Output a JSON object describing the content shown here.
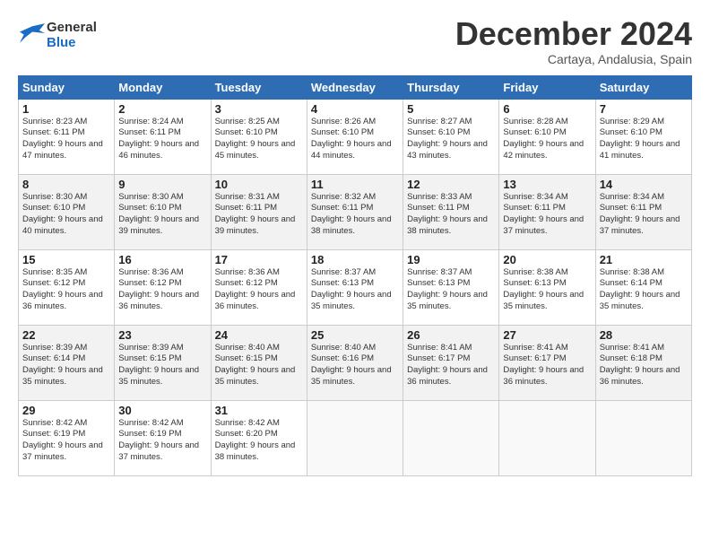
{
  "header": {
    "logo_line1": "General",
    "logo_line2": "Blue",
    "title": "December 2024",
    "subtitle": "Cartaya, Andalusia, Spain"
  },
  "weekdays": [
    "Sunday",
    "Monday",
    "Tuesday",
    "Wednesday",
    "Thursday",
    "Friday",
    "Saturday"
  ],
  "weeks": [
    [
      {
        "day": "1",
        "sunrise": "Sunrise: 8:23 AM",
        "sunset": "Sunset: 6:11 PM",
        "daylight": "Daylight: 9 hours and 47 minutes."
      },
      {
        "day": "2",
        "sunrise": "Sunrise: 8:24 AM",
        "sunset": "Sunset: 6:11 PM",
        "daylight": "Daylight: 9 hours and 46 minutes."
      },
      {
        "day": "3",
        "sunrise": "Sunrise: 8:25 AM",
        "sunset": "Sunset: 6:10 PM",
        "daylight": "Daylight: 9 hours and 45 minutes."
      },
      {
        "day": "4",
        "sunrise": "Sunrise: 8:26 AM",
        "sunset": "Sunset: 6:10 PM",
        "daylight": "Daylight: 9 hours and 44 minutes."
      },
      {
        "day": "5",
        "sunrise": "Sunrise: 8:27 AM",
        "sunset": "Sunset: 6:10 PM",
        "daylight": "Daylight: 9 hours and 43 minutes."
      },
      {
        "day": "6",
        "sunrise": "Sunrise: 8:28 AM",
        "sunset": "Sunset: 6:10 PM",
        "daylight": "Daylight: 9 hours and 42 minutes."
      },
      {
        "day": "7",
        "sunrise": "Sunrise: 8:29 AM",
        "sunset": "Sunset: 6:10 PM",
        "daylight": "Daylight: 9 hours and 41 minutes."
      }
    ],
    [
      {
        "day": "8",
        "sunrise": "Sunrise: 8:30 AM",
        "sunset": "Sunset: 6:10 PM",
        "daylight": "Daylight: 9 hours and 40 minutes."
      },
      {
        "day": "9",
        "sunrise": "Sunrise: 8:30 AM",
        "sunset": "Sunset: 6:10 PM",
        "daylight": "Daylight: 9 hours and 39 minutes."
      },
      {
        "day": "10",
        "sunrise": "Sunrise: 8:31 AM",
        "sunset": "Sunset: 6:11 PM",
        "daylight": "Daylight: 9 hours and 39 minutes."
      },
      {
        "day": "11",
        "sunrise": "Sunrise: 8:32 AM",
        "sunset": "Sunset: 6:11 PM",
        "daylight": "Daylight: 9 hours and 38 minutes."
      },
      {
        "day": "12",
        "sunrise": "Sunrise: 8:33 AM",
        "sunset": "Sunset: 6:11 PM",
        "daylight": "Daylight: 9 hours and 38 minutes."
      },
      {
        "day": "13",
        "sunrise": "Sunrise: 8:34 AM",
        "sunset": "Sunset: 6:11 PM",
        "daylight": "Daylight: 9 hours and 37 minutes."
      },
      {
        "day": "14",
        "sunrise": "Sunrise: 8:34 AM",
        "sunset": "Sunset: 6:11 PM",
        "daylight": "Daylight: 9 hours and 37 minutes."
      }
    ],
    [
      {
        "day": "15",
        "sunrise": "Sunrise: 8:35 AM",
        "sunset": "Sunset: 6:12 PM",
        "daylight": "Daylight: 9 hours and 36 minutes."
      },
      {
        "day": "16",
        "sunrise": "Sunrise: 8:36 AM",
        "sunset": "Sunset: 6:12 PM",
        "daylight": "Daylight: 9 hours and 36 minutes."
      },
      {
        "day": "17",
        "sunrise": "Sunrise: 8:36 AM",
        "sunset": "Sunset: 6:12 PM",
        "daylight": "Daylight: 9 hours and 36 minutes."
      },
      {
        "day": "18",
        "sunrise": "Sunrise: 8:37 AM",
        "sunset": "Sunset: 6:13 PM",
        "daylight": "Daylight: 9 hours and 35 minutes."
      },
      {
        "day": "19",
        "sunrise": "Sunrise: 8:37 AM",
        "sunset": "Sunset: 6:13 PM",
        "daylight": "Daylight: 9 hours and 35 minutes."
      },
      {
        "day": "20",
        "sunrise": "Sunrise: 8:38 AM",
        "sunset": "Sunset: 6:13 PM",
        "daylight": "Daylight: 9 hours and 35 minutes."
      },
      {
        "day": "21",
        "sunrise": "Sunrise: 8:38 AM",
        "sunset": "Sunset: 6:14 PM",
        "daylight": "Daylight: 9 hours and 35 minutes."
      }
    ],
    [
      {
        "day": "22",
        "sunrise": "Sunrise: 8:39 AM",
        "sunset": "Sunset: 6:14 PM",
        "daylight": "Daylight: 9 hours and 35 minutes."
      },
      {
        "day": "23",
        "sunrise": "Sunrise: 8:39 AM",
        "sunset": "Sunset: 6:15 PM",
        "daylight": "Daylight: 9 hours and 35 minutes."
      },
      {
        "day": "24",
        "sunrise": "Sunrise: 8:40 AM",
        "sunset": "Sunset: 6:15 PM",
        "daylight": "Daylight: 9 hours and 35 minutes."
      },
      {
        "day": "25",
        "sunrise": "Sunrise: 8:40 AM",
        "sunset": "Sunset: 6:16 PM",
        "daylight": "Daylight: 9 hours and 35 minutes."
      },
      {
        "day": "26",
        "sunrise": "Sunrise: 8:41 AM",
        "sunset": "Sunset: 6:17 PM",
        "daylight": "Daylight: 9 hours and 36 minutes."
      },
      {
        "day": "27",
        "sunrise": "Sunrise: 8:41 AM",
        "sunset": "Sunset: 6:17 PM",
        "daylight": "Daylight: 9 hours and 36 minutes."
      },
      {
        "day": "28",
        "sunrise": "Sunrise: 8:41 AM",
        "sunset": "Sunset: 6:18 PM",
        "daylight": "Daylight: 9 hours and 36 minutes."
      }
    ],
    [
      {
        "day": "29",
        "sunrise": "Sunrise: 8:42 AM",
        "sunset": "Sunset: 6:19 PM",
        "daylight": "Daylight: 9 hours and 37 minutes."
      },
      {
        "day": "30",
        "sunrise": "Sunrise: 8:42 AM",
        "sunset": "Sunset: 6:19 PM",
        "daylight": "Daylight: 9 hours and 37 minutes."
      },
      {
        "day": "31",
        "sunrise": "Sunrise: 8:42 AM",
        "sunset": "Sunset: 6:20 PM",
        "daylight": "Daylight: 9 hours and 38 minutes."
      },
      null,
      null,
      null,
      null
    ]
  ]
}
